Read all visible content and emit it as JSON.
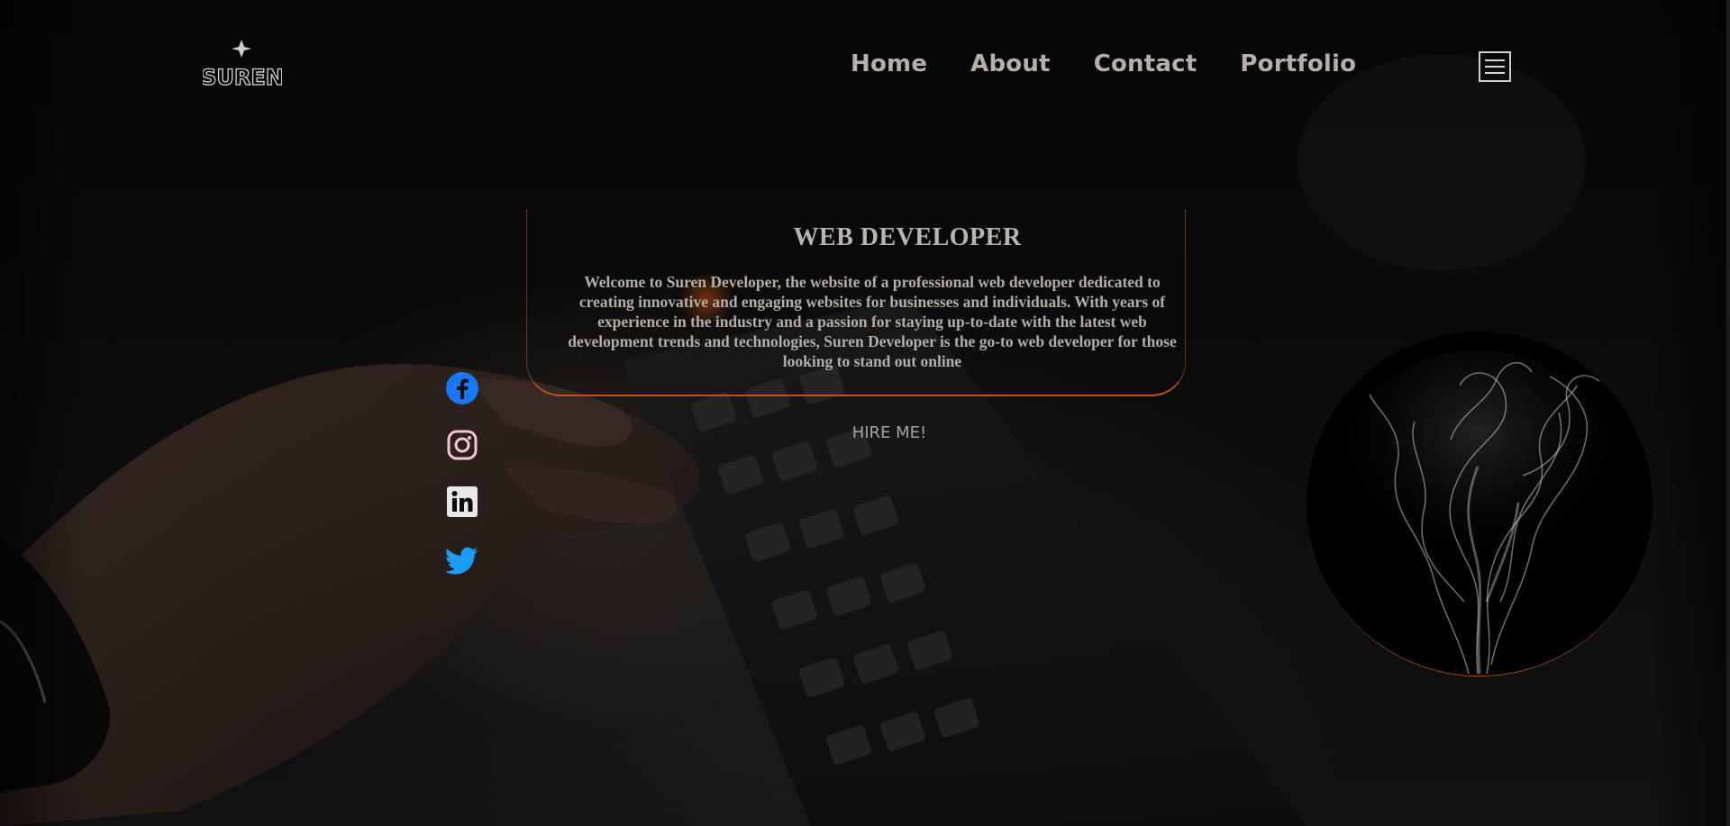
{
  "header": {
    "logo_text": "SUREN",
    "nav": [
      {
        "label": "Home"
      },
      {
        "label": "About"
      },
      {
        "label": "Contact"
      },
      {
        "label": "Portfolio"
      }
    ],
    "menu_icon": "hamburger-menu-icon"
  },
  "hero": {
    "title": "WEB DEVELOPER",
    "description": "Welcome to Suren Developer, the website of a professional web developer dedicated to creating innovative and engaging websites for businesses and individuals. With years of experience in the industry and a passion for staying up-to-date with the latest web development trends and technologies, Suren Developer is the go-to web developer for those looking to stand out online",
    "cta_label": "HIRE ME!"
  },
  "socials": [
    {
      "name": "facebook-icon",
      "color": "#1877f2"
    },
    {
      "name": "instagram-icon",
      "color": "#f5c6d6"
    },
    {
      "name": "linkedin-icon",
      "color": "#e8e8e8"
    },
    {
      "name": "twitter-icon",
      "color": "#1d9bf0"
    }
  ],
  "colors": {
    "accent": "#c0551c",
    "text": "#b8b0a6",
    "background": "#050505"
  }
}
